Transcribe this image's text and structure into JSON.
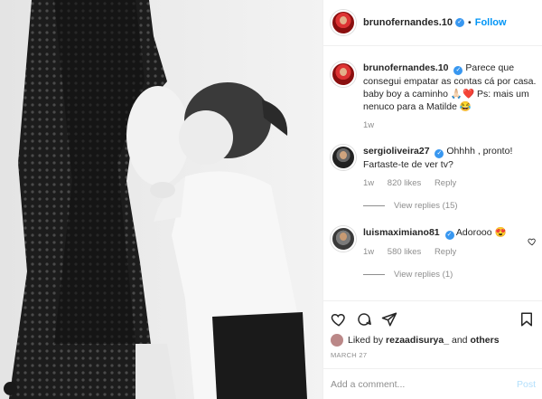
{
  "header": {
    "username": "brunofernandes.10",
    "separator": "•",
    "follow_label": "Follow"
  },
  "caption": {
    "username": "brunofernandes.10",
    "text": "Parece que consegui empatar as contas cá por casa. baby boy a caminho 🙏🏻❤️ Ps: mais um nenuco para a Matilde 😂",
    "time": "1w"
  },
  "comments": [
    {
      "username": "sergioliveira27",
      "text": "Ohhhh , pronto! Fartaste-te de ver tv?",
      "time": "1w",
      "likes": "820 likes",
      "reply_label": "Reply",
      "view_replies": "View replies (15)"
    },
    {
      "username": "luismaximiano81",
      "text": "Adorooo 😍",
      "time": "1w",
      "likes": "580 likes",
      "reply_label": "Reply",
      "view_replies": "View replies (1)"
    }
  ],
  "likes_row": {
    "prefix": "Liked by ",
    "user": "rezaadisurya_",
    "middle": " and ",
    "others": "others"
  },
  "date": "MARCH 27",
  "comment_box": {
    "placeholder": "Add a comment...",
    "post_label": "Post"
  },
  "colors": {
    "link_blue": "#0095f6",
    "verified_blue": "#3897f0",
    "muted_gray": "#8e8e8e",
    "post_disabled": "#b2dffc"
  },
  "icons": [
    "heart-icon",
    "comment-icon",
    "share-icon",
    "bookmark-icon",
    "verified-icon",
    "heart-small-icon"
  ]
}
